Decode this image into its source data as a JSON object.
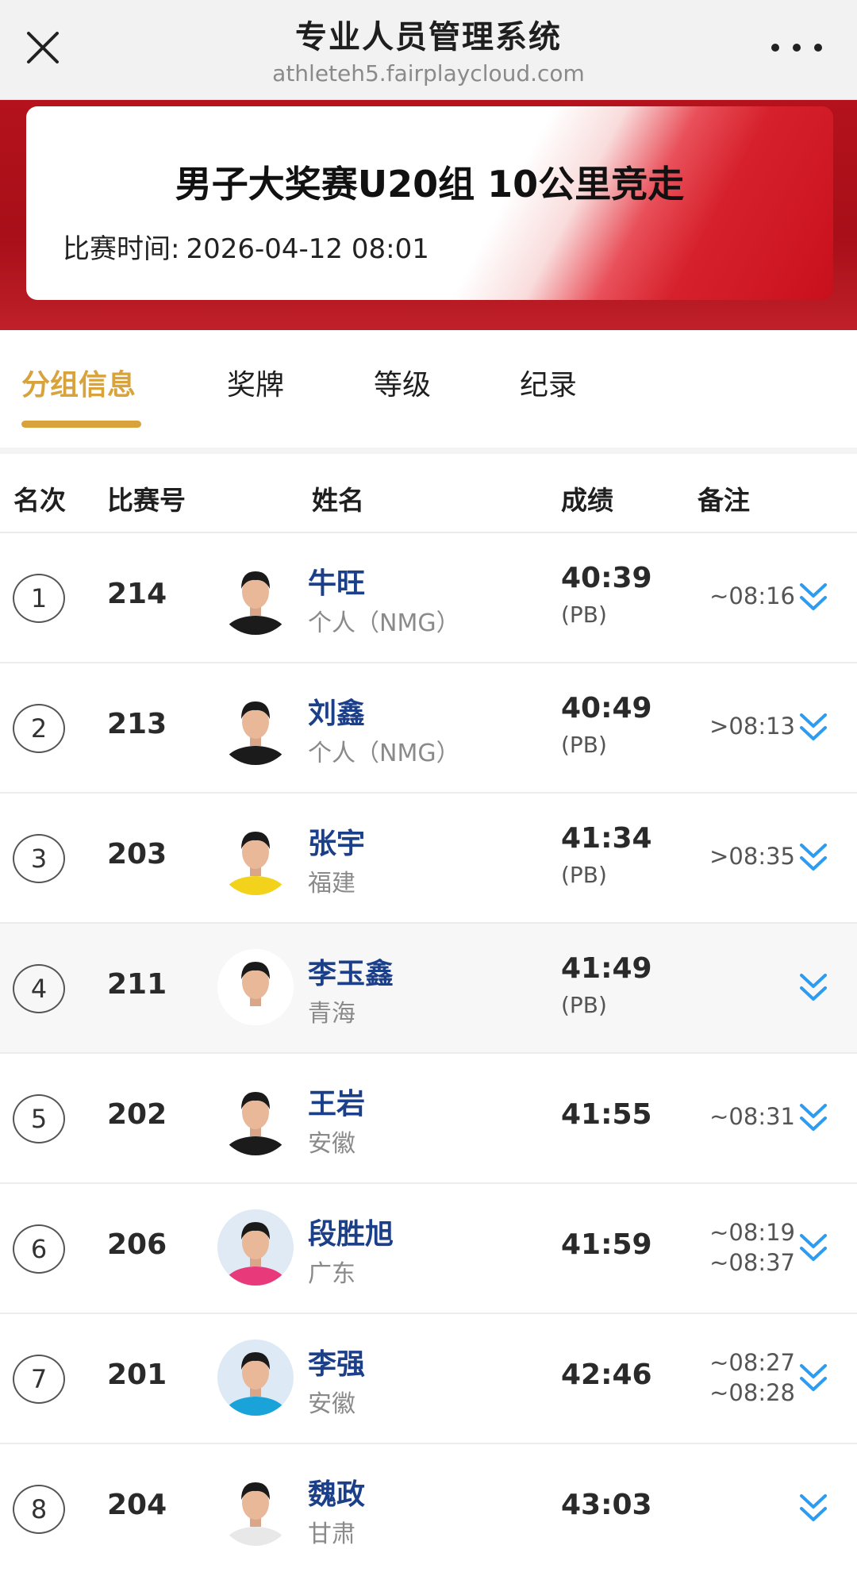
{
  "app": {
    "title": "专业人员管理系统",
    "url": "athleteh5.fairplaycloud.com"
  },
  "event": {
    "name": "男子大奖赛U20组 10公里竞走",
    "time_label": "比赛时间:",
    "time_value": "2026-04-12  08:01"
  },
  "tabs": [
    {
      "label": "分组信息",
      "active": true
    },
    {
      "label": "奖牌",
      "active": false
    },
    {
      "label": "等级",
      "active": false
    },
    {
      "label": "纪录",
      "active": false
    }
  ],
  "columns": {
    "rank": "名次",
    "bib": "比赛号",
    "name": "姓名",
    "result": "成绩",
    "note": "备注"
  },
  "rows": [
    {
      "rank": "1",
      "bib": "214",
      "name": "牛旺",
      "team": "个人（NMG）",
      "result": "40:39",
      "pb": "(PB)",
      "note1": "~08:16",
      "note2": ""
    },
    {
      "rank": "2",
      "bib": "213",
      "name": "刘鑫",
      "team": "个人（NMG）",
      "result": "40:49",
      "pb": "(PB)",
      "note1": ">08:13",
      "note2": ""
    },
    {
      "rank": "3",
      "bib": "203",
      "name": "张宇",
      "team": "福建",
      "result": "41:34",
      "pb": "(PB)",
      "note1": ">08:35",
      "note2": ""
    },
    {
      "rank": "4",
      "bib": "211",
      "name": "李玉鑫",
      "team": "青海",
      "result": "41:49",
      "pb": "(PB)",
      "note1": "",
      "note2": ""
    },
    {
      "rank": "5",
      "bib": "202",
      "name": "王岩",
      "team": "安徽",
      "result": "41:55",
      "pb": "",
      "note1": "~08:31",
      "note2": ""
    },
    {
      "rank": "6",
      "bib": "206",
      "name": "段胜旭",
      "team": "广东",
      "result": "41:59",
      "pb": "",
      "note1": "~08:19",
      "note2": "~08:37"
    },
    {
      "rank": "7",
      "bib": "201",
      "name": "李强",
      "team": "安徽",
      "result": "42:46",
      "pb": "",
      "note1": "~08:27",
      "note2": "~08:28"
    },
    {
      "rank": "8",
      "bib": "204",
      "name": "魏政",
      "team": "甘肃",
      "result": "43:03",
      "pb": "",
      "note1": "",
      "note2": ""
    }
  ],
  "colors": {
    "accent": "#d9a33c",
    "name_blue": "#1c3f8a",
    "chevron_blue": "#2d9cf0",
    "banner_red": "#b4121c"
  },
  "icons": {
    "close": "close-icon",
    "more": "more-icon",
    "expand": "chevron-double-down-icon",
    "avatar": "athlete-photo"
  }
}
